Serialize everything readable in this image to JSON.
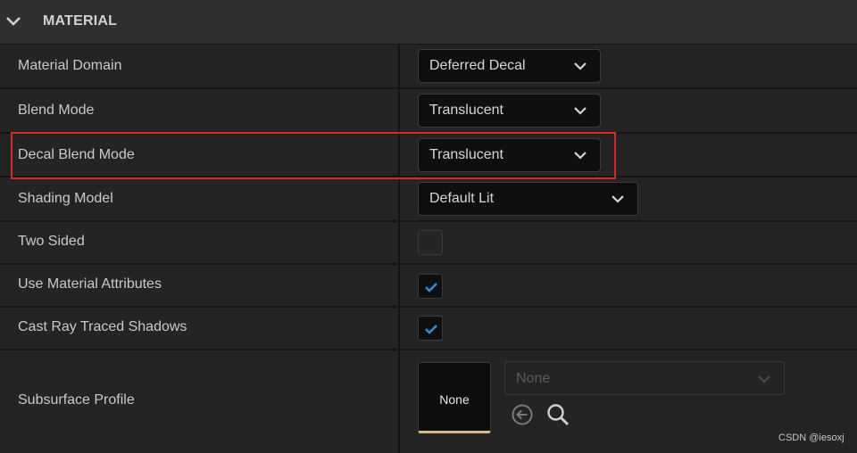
{
  "section": {
    "title": "MATERIAL"
  },
  "properties": {
    "material_domain": {
      "label": "Material Domain",
      "value": "Deferred Decal"
    },
    "blend_mode": {
      "label": "Blend Mode",
      "value": "Translucent"
    },
    "decal_blend_mode": {
      "label": "Decal Blend Mode",
      "value": "Translucent"
    },
    "shading_model": {
      "label": "Shading Model",
      "value": "Default Lit"
    },
    "two_sided": {
      "label": "Two Sided",
      "checked": false
    },
    "use_material_attributes": {
      "label": "Use Material Attributes",
      "checked": true
    },
    "cast_ray_traced_shadows": {
      "label": "Cast Ray Traced Shadows",
      "checked": true
    },
    "subsurface_profile": {
      "label": "Subsurface Profile",
      "thumbnail_label": "None",
      "asset_value": "None"
    }
  },
  "icons": {
    "collapse": "chevron-down-icon",
    "dropdown": "chevron-down-icon",
    "check": "check-icon",
    "use_selected": "arrow-left-circle-icon",
    "browse": "search-icon"
  },
  "colors": {
    "accent_check": "#2a8fd8",
    "highlight": "#d62a2a",
    "thumbnail_underline": "#d7b987"
  },
  "watermark": "CSDN @iesoxj"
}
